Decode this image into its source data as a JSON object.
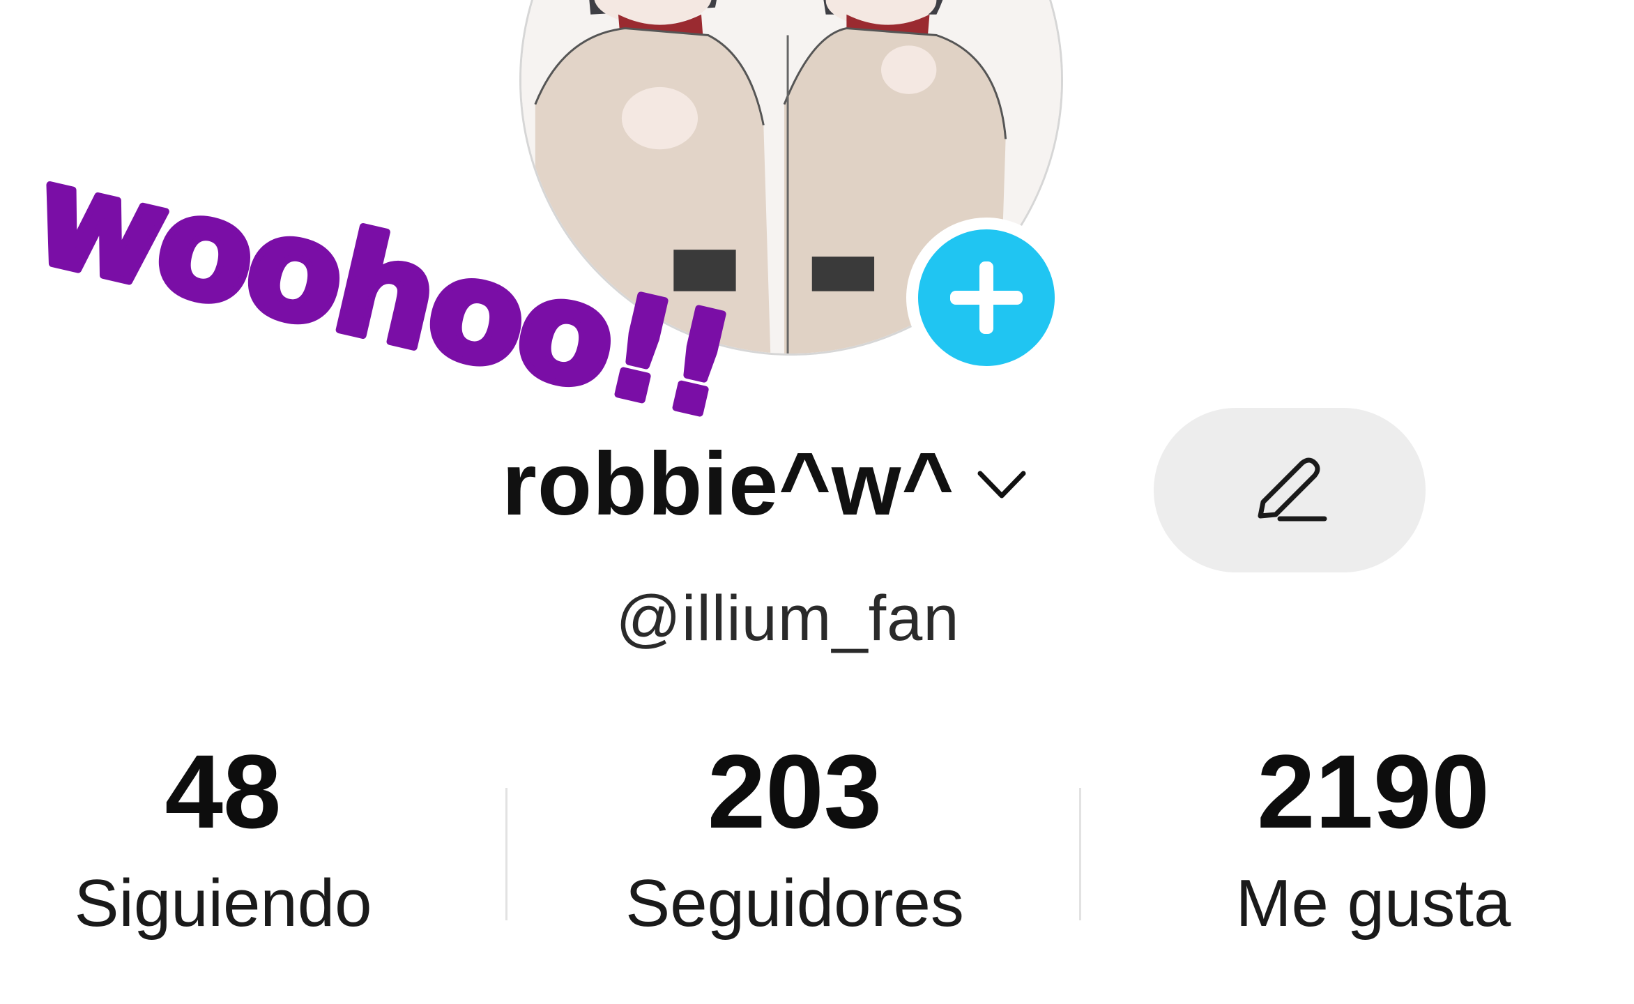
{
  "profile": {
    "display_name": "robbie^w^",
    "username": "@illium_fan",
    "sticker_text": "woohoo!!"
  },
  "stats": [
    {
      "value": "48",
      "label": "Siguiendo"
    },
    {
      "value": "203",
      "label": "Seguidores"
    },
    {
      "value": "2190",
      "label": "Me gusta"
    }
  ],
  "colors": {
    "accent": "#20c5f2",
    "sticker": "#7a0ea6",
    "edit_button_bg": "#ededed"
  },
  "icons": {
    "add": "plus-icon",
    "dropdown": "chevron-down-icon",
    "edit": "pencil-icon"
  }
}
